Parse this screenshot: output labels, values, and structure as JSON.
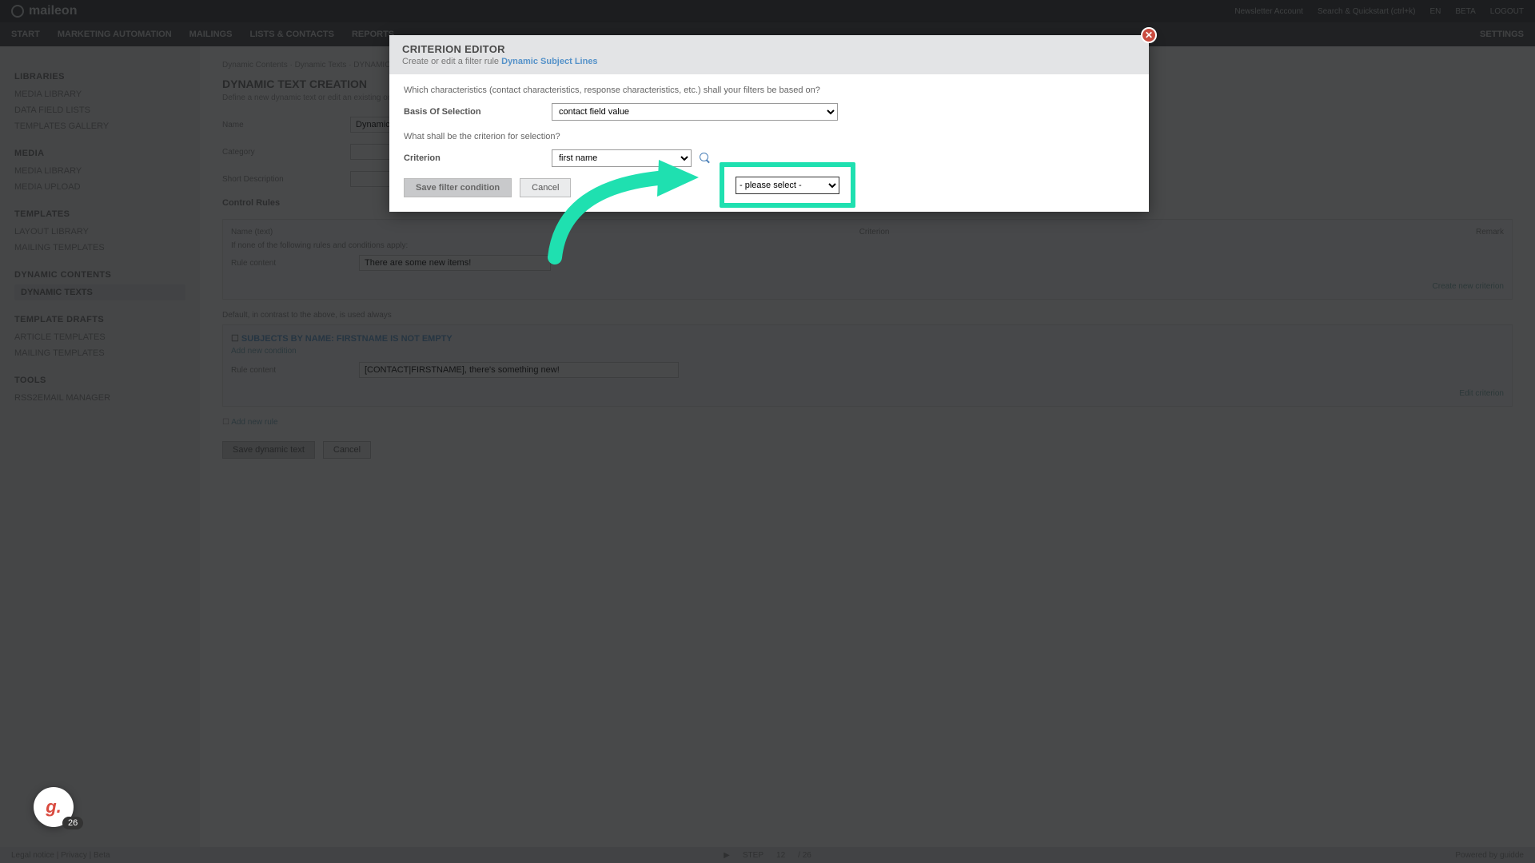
{
  "brand": "maileon",
  "topbar": {
    "newsletter_account": "Newsletter Account",
    "search_placeholder": "Search & Quickstart (ctrl+k)",
    "lang": "EN",
    "beta": "BETA",
    "logout": "LOGOUT"
  },
  "nav": {
    "items": [
      "START",
      "MARKETING AUTOMATION",
      "MAILINGS",
      "LISTS & CONTACTS",
      "REPORTS"
    ],
    "settings": "SETTINGS"
  },
  "sidebar": {
    "sections": [
      {
        "title": "LIBRARIES",
        "items": [
          "MEDIA LIBRARY",
          "DATA FIELD LISTS",
          "TEMPLATES GALLERY"
        ]
      },
      {
        "title": "MEDIA",
        "items": [
          "MEDIA LIBRARY",
          "MEDIA UPLOAD"
        ]
      },
      {
        "title": "TEMPLATES",
        "items": [
          "LAYOUT LIBRARY",
          "MAILING TEMPLATES"
        ]
      },
      {
        "title": "DYNAMIC CONTENTS",
        "items": [
          "DYNAMIC TEXTS"
        ]
      },
      {
        "title": "TEMPLATE DRAFTS",
        "items": [
          "ARTICLE TEMPLATES",
          "MAILING TEMPLATES"
        ]
      },
      {
        "title": "TOOLS",
        "items": [
          "RSS2EMAIL MANAGER"
        ]
      }
    ],
    "active": "DYNAMIC TEXTS"
  },
  "main": {
    "breadcrumb": "Dynamic Contents  ·  Dynamic Texts  ·  DYNAMIC SUBJECT LINES",
    "title": "DYNAMIC TEXT CREATION",
    "subtitle": "Define a new dynamic text or edit an existing one.",
    "labels": {
      "name": "Name",
      "category": "Category",
      "short_desc": "Short Description",
      "control_rules": "Control Rules"
    },
    "values": {
      "name": "Dynamic Subject Lines",
      "category": "",
      "short_desc": ""
    },
    "control_headers": {
      "name": "Name (text)",
      "criterion": "Criterion",
      "remark": "Remark"
    },
    "rule_hint": "If none of the following rules and conditions apply:",
    "rule_default": "Rule content",
    "rule_default_val": "There are some new items!",
    "default_rule_title": "Default, in contrast to the above, is used always",
    "rule1_title": "SUBJECTS BY NAME: FIRSTNAME IS NOT EMPTY",
    "rule1_sub": "Add new condition",
    "rule1_content_label": "Rule content",
    "rule1_content_value": "[CONTACT|FIRSTNAME], there's something new!",
    "add_rule": "Add new rule",
    "buttons": {
      "save": "Save dynamic text",
      "cancel": "Cancel"
    },
    "rule_actions": {
      "create": "Create new criterion",
      "edit": "Edit criterion"
    }
  },
  "modal": {
    "title": "CRITERION EDITOR",
    "subtitle_prefix": "Create or edit a filter rule ",
    "subtitle_link": "Dynamic Subject Lines",
    "q1": "Which characteristics (contact characteristics, response characteristics, etc.) shall your filters be based on?",
    "basis_label": "Basis Of Selection",
    "basis_value": "contact field value",
    "q2": "What shall be the criterion for selection?",
    "criterion_label": "Criterion",
    "criterion_value": "first name",
    "operator_value": "- please select -",
    "save": "Save filter condition",
    "cancel": "Cancel"
  },
  "badge": {
    "letter": "g.",
    "count": "26"
  },
  "footer": {
    "left": "Legal notice  |  Privacy  |  Beta",
    "play_label": "STEP",
    "step": "12",
    "of": "/ 26",
    "right": "Powered by  guidde"
  }
}
